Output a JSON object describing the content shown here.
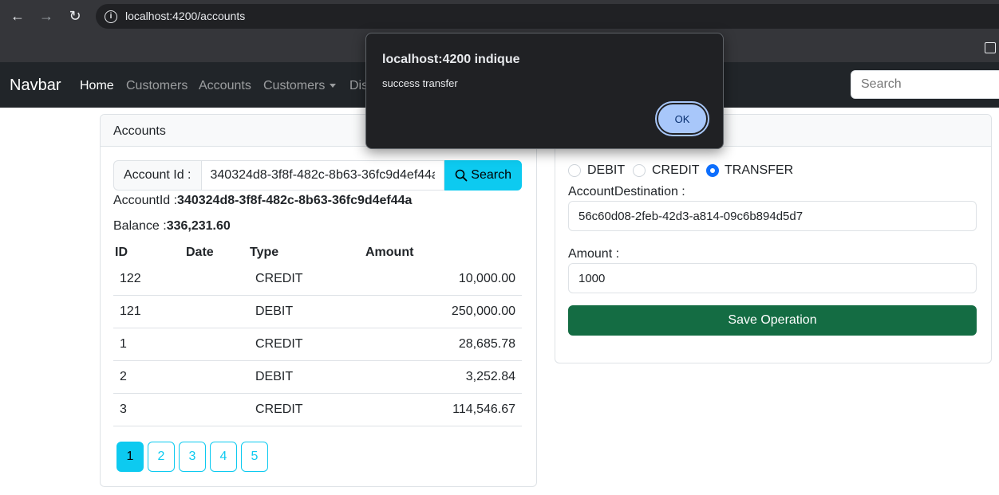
{
  "browser": {
    "url": "localhost:4200/accounts"
  },
  "navbar": {
    "brand": "Navbar",
    "links": [
      "Home",
      "Customers",
      "Accounts",
      "Customers",
      "Dis"
    ],
    "search_placeholder": "Search"
  },
  "accounts_card": {
    "header": "Accounts",
    "account_id_label": "Account Id :",
    "account_id_value": "340324d8-3f8f-482c-8b63-36fc9d4ef44a",
    "search_button": "Search",
    "account_id_info_label": "AccountId :",
    "account_id_info_value": "340324d8-3f8f-482c-8b63-36fc9d4ef44a",
    "balance_label": "Balance :",
    "balance_value": "336,231.60",
    "table": {
      "columns": [
        "ID",
        "Date",
        "Type",
        "Amount"
      ],
      "rows": [
        {
          "id": "122",
          "date": "",
          "type": "CREDIT",
          "amount": "10,000.00"
        },
        {
          "id": "121",
          "date": "",
          "type": "DEBIT",
          "amount": "250,000.00"
        },
        {
          "id": "1",
          "date": "",
          "type": "CREDIT",
          "amount": "28,685.78"
        },
        {
          "id": "2",
          "date": "",
          "type": "DEBIT",
          "amount": "3,252.84"
        },
        {
          "id": "3",
          "date": "",
          "type": "CREDIT",
          "amount": "114,546.67"
        }
      ]
    },
    "pages": [
      "1",
      "2",
      "3",
      "4",
      "5"
    ],
    "active_page": "1"
  },
  "operations_card": {
    "radios": [
      {
        "label": "DEBIT",
        "checked": false
      },
      {
        "label": "CREDIT",
        "checked": false
      },
      {
        "label": "TRANSFER",
        "checked": true
      }
    ],
    "destination_label": "AccountDestination :",
    "destination_value": "56c60d08-2feb-42d3-a814-09c6b894d5d7",
    "amount_label": "Amount :",
    "amount_value": "1000",
    "save_button": "Save Operation"
  },
  "dialog": {
    "title": "localhost:4200 indique",
    "message": "success transfer",
    "ok_button": "OK"
  },
  "colors": {
    "info": "#0dcaf0",
    "success": "#146c43",
    "primary": "#0d6efd",
    "navbar_bg": "#212529"
  }
}
